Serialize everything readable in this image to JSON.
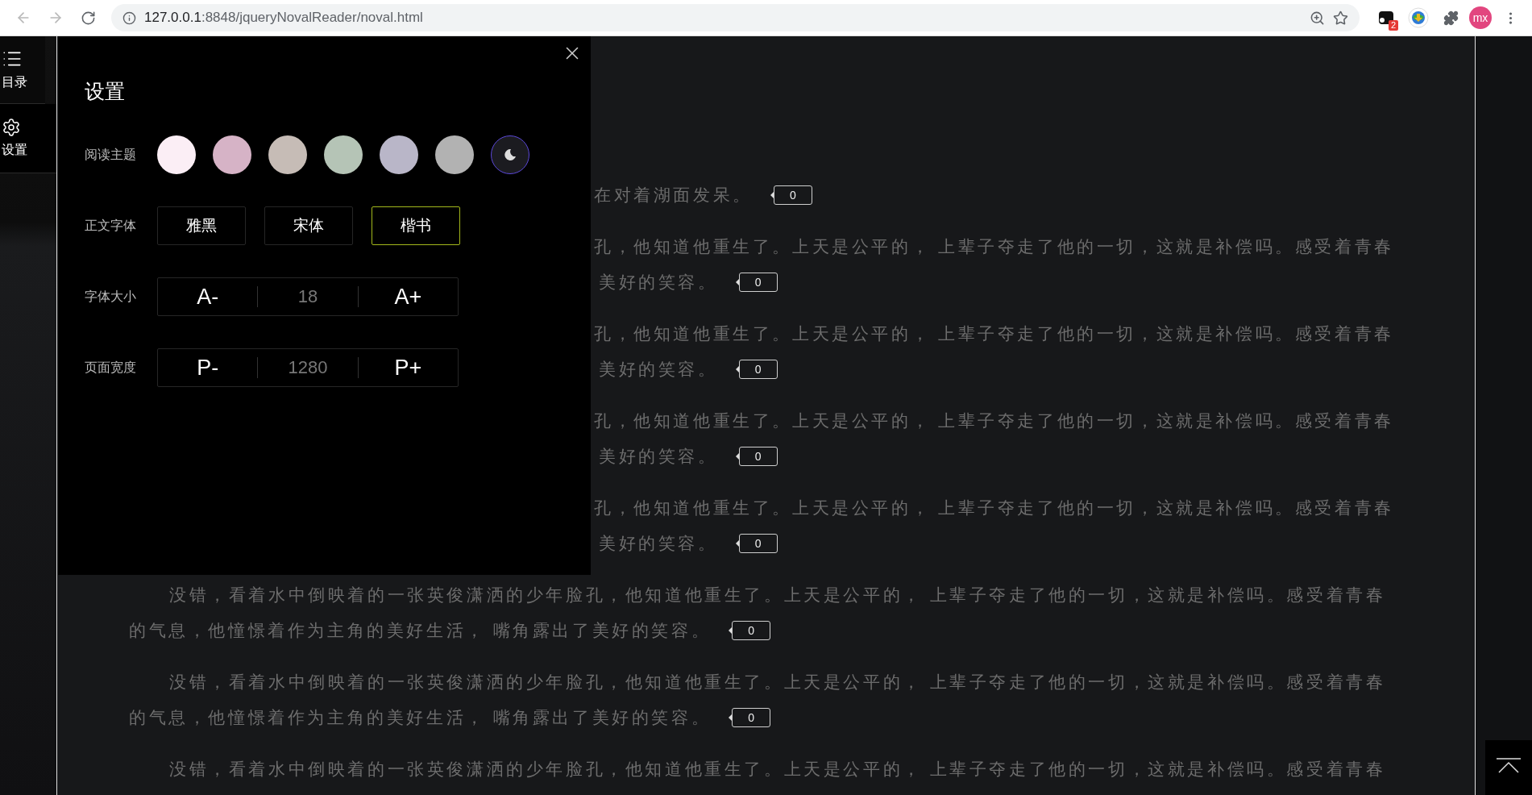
{
  "browser": {
    "back": {
      "disabled": true
    },
    "forward": {
      "disabled": true
    },
    "url_host": "127.0.0.1",
    "url_path": ":8848/jqueryNovalReader/noval.html",
    "extension_badge": "2",
    "profile_initials": "mx"
  },
  "sidebar": [
    {
      "kind": "toc",
      "label": "目录"
    },
    {
      "kind": "settings",
      "label": "设置"
    }
  ],
  "settings": {
    "title": "设置",
    "theme": {
      "label": "阅读主题",
      "swatches": [
        {
          "kind": "color",
          "color": "#fbeef5",
          "selected": false
        },
        {
          "kind": "color",
          "color": "#d6b3c6",
          "selected": false
        },
        {
          "kind": "color",
          "color": "#c6bcb6",
          "selected": false
        },
        {
          "kind": "color",
          "color": "#b5c4b6",
          "selected": false
        },
        {
          "kind": "color",
          "color": "#b9b6c8",
          "selected": false
        },
        {
          "kind": "color",
          "color": "#b2b2b2",
          "selected": false
        },
        {
          "kind": "night",
          "color": "#1b1b20",
          "selected": true
        }
      ]
    },
    "font": {
      "label": "正文字体",
      "options": [
        {
          "label": "雅黑",
          "selected": false
        },
        {
          "label": "宋体",
          "selected": false
        },
        {
          "label": "楷书",
          "selected": true
        }
      ]
    },
    "font_size": {
      "label": "字体大小",
      "decrease": "A-",
      "value": "18",
      "increase": "A+"
    },
    "page_width": {
      "label": "页面宽度",
      "decrease": "P-",
      "value": "1280",
      "increase": "P+"
    }
  },
  "content": {
    "paragraphs": [
      {
        "clipped": true,
        "lines": [
          "在对着湖面发呆。"
        ],
        "counter": "0"
      },
      {
        "clipped": true,
        "lines": [
          "孔，他知道他重生了。上天是公平的， 上辈子夺走了他的一切，这就是补偿吗。感受着青春",
          "美好的笑容。"
        ],
        "counter": "0"
      },
      {
        "clipped": true,
        "lines": [
          "孔，他知道他重生了。上天是公平的， 上辈子夺走了他的一切，这就是补偿吗。感受着青春",
          "美好的笑容。"
        ],
        "counter": "0"
      },
      {
        "clipped": true,
        "lines": [
          "孔，他知道他重生了。上天是公平的， 上辈子夺走了他的一切，这就是补偿吗。感受着青春",
          "美好的笑容。"
        ],
        "counter": "0"
      },
      {
        "clipped": true,
        "lines": [
          "孔，他知道他重生了。上天是公平的， 上辈子夺走了他的一切，这就是补偿吗。感受着青春",
          "美好的笑容。"
        ],
        "counter": "0"
      },
      {
        "clipped": false,
        "lines": [
          "没错，看着水中倒映着的一张英俊潇洒的少年脸孔，他知道他重生了。上天是公平的， 上辈子夺走了他的一切，这就是补偿吗。感受着青春",
          "的气息，他憧憬着作为主角的美好生活， 嘴角露出了美好的笑容。"
        ],
        "counter": "0"
      },
      {
        "clipped": false,
        "lines": [
          "没错，看着水中倒映着的一张英俊潇洒的少年脸孔，他知道他重生了。上天是公平的， 上辈子夺走了他的一切，这就是补偿吗。感受着青春",
          "的气息，他憧憬着作为主角的美好生活， 嘴角露出了美好的笑容。"
        ],
        "counter": "0"
      },
      {
        "clipped": false,
        "lines": [
          "没错，看着水中倒映着的一张英俊潇洒的少年脸孔，他知道他重生了。上天是公平的， 上辈子夺走了他的一切，这就是补偿吗。感受着青春"
        ]
      }
    ]
  }
}
